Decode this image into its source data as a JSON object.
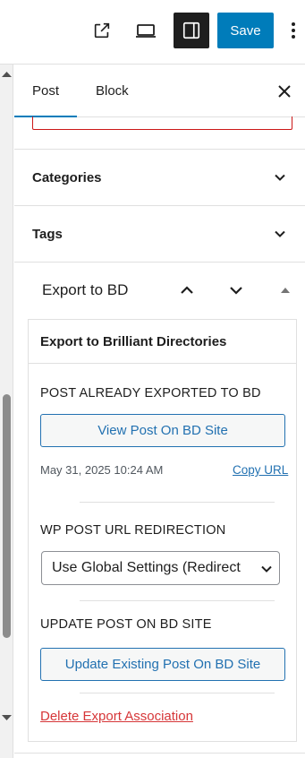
{
  "toolbar": {
    "save_label": "Save",
    "icons": [
      "external-link-icon",
      "desktop-preview-icon",
      "settings-sidebar-icon",
      "more-options-icon"
    ],
    "active_color": "#1e1e1e",
    "save_color": "#007cba"
  },
  "sidebar": {
    "tabs": [
      {
        "label": "Post",
        "active": true
      },
      {
        "label": "Block",
        "active": false
      }
    ],
    "close_icon": "close-icon"
  },
  "panels": {
    "categories": "Categories",
    "tags": "Tags",
    "export": "Export to BD"
  },
  "bd": {
    "heading": "Export to Brilliant Directories",
    "exported_label": "POST ALREADY EXPORTED TO BD",
    "view_button": "View Post On BD Site",
    "date": "May 31, 2025 10:24 AM",
    "copy_url": "Copy URL",
    "redirect_label": "WP POST URL REDIRECTION",
    "redirect_value": "Use Global Settings (Redirect",
    "update_label": "UPDATE POST ON BD SITE",
    "update_button": "Update Existing Post On BD Site",
    "delete_link": "Delete Export Association",
    "link_color": "#2271b1",
    "danger_color": "#d63638"
  }
}
